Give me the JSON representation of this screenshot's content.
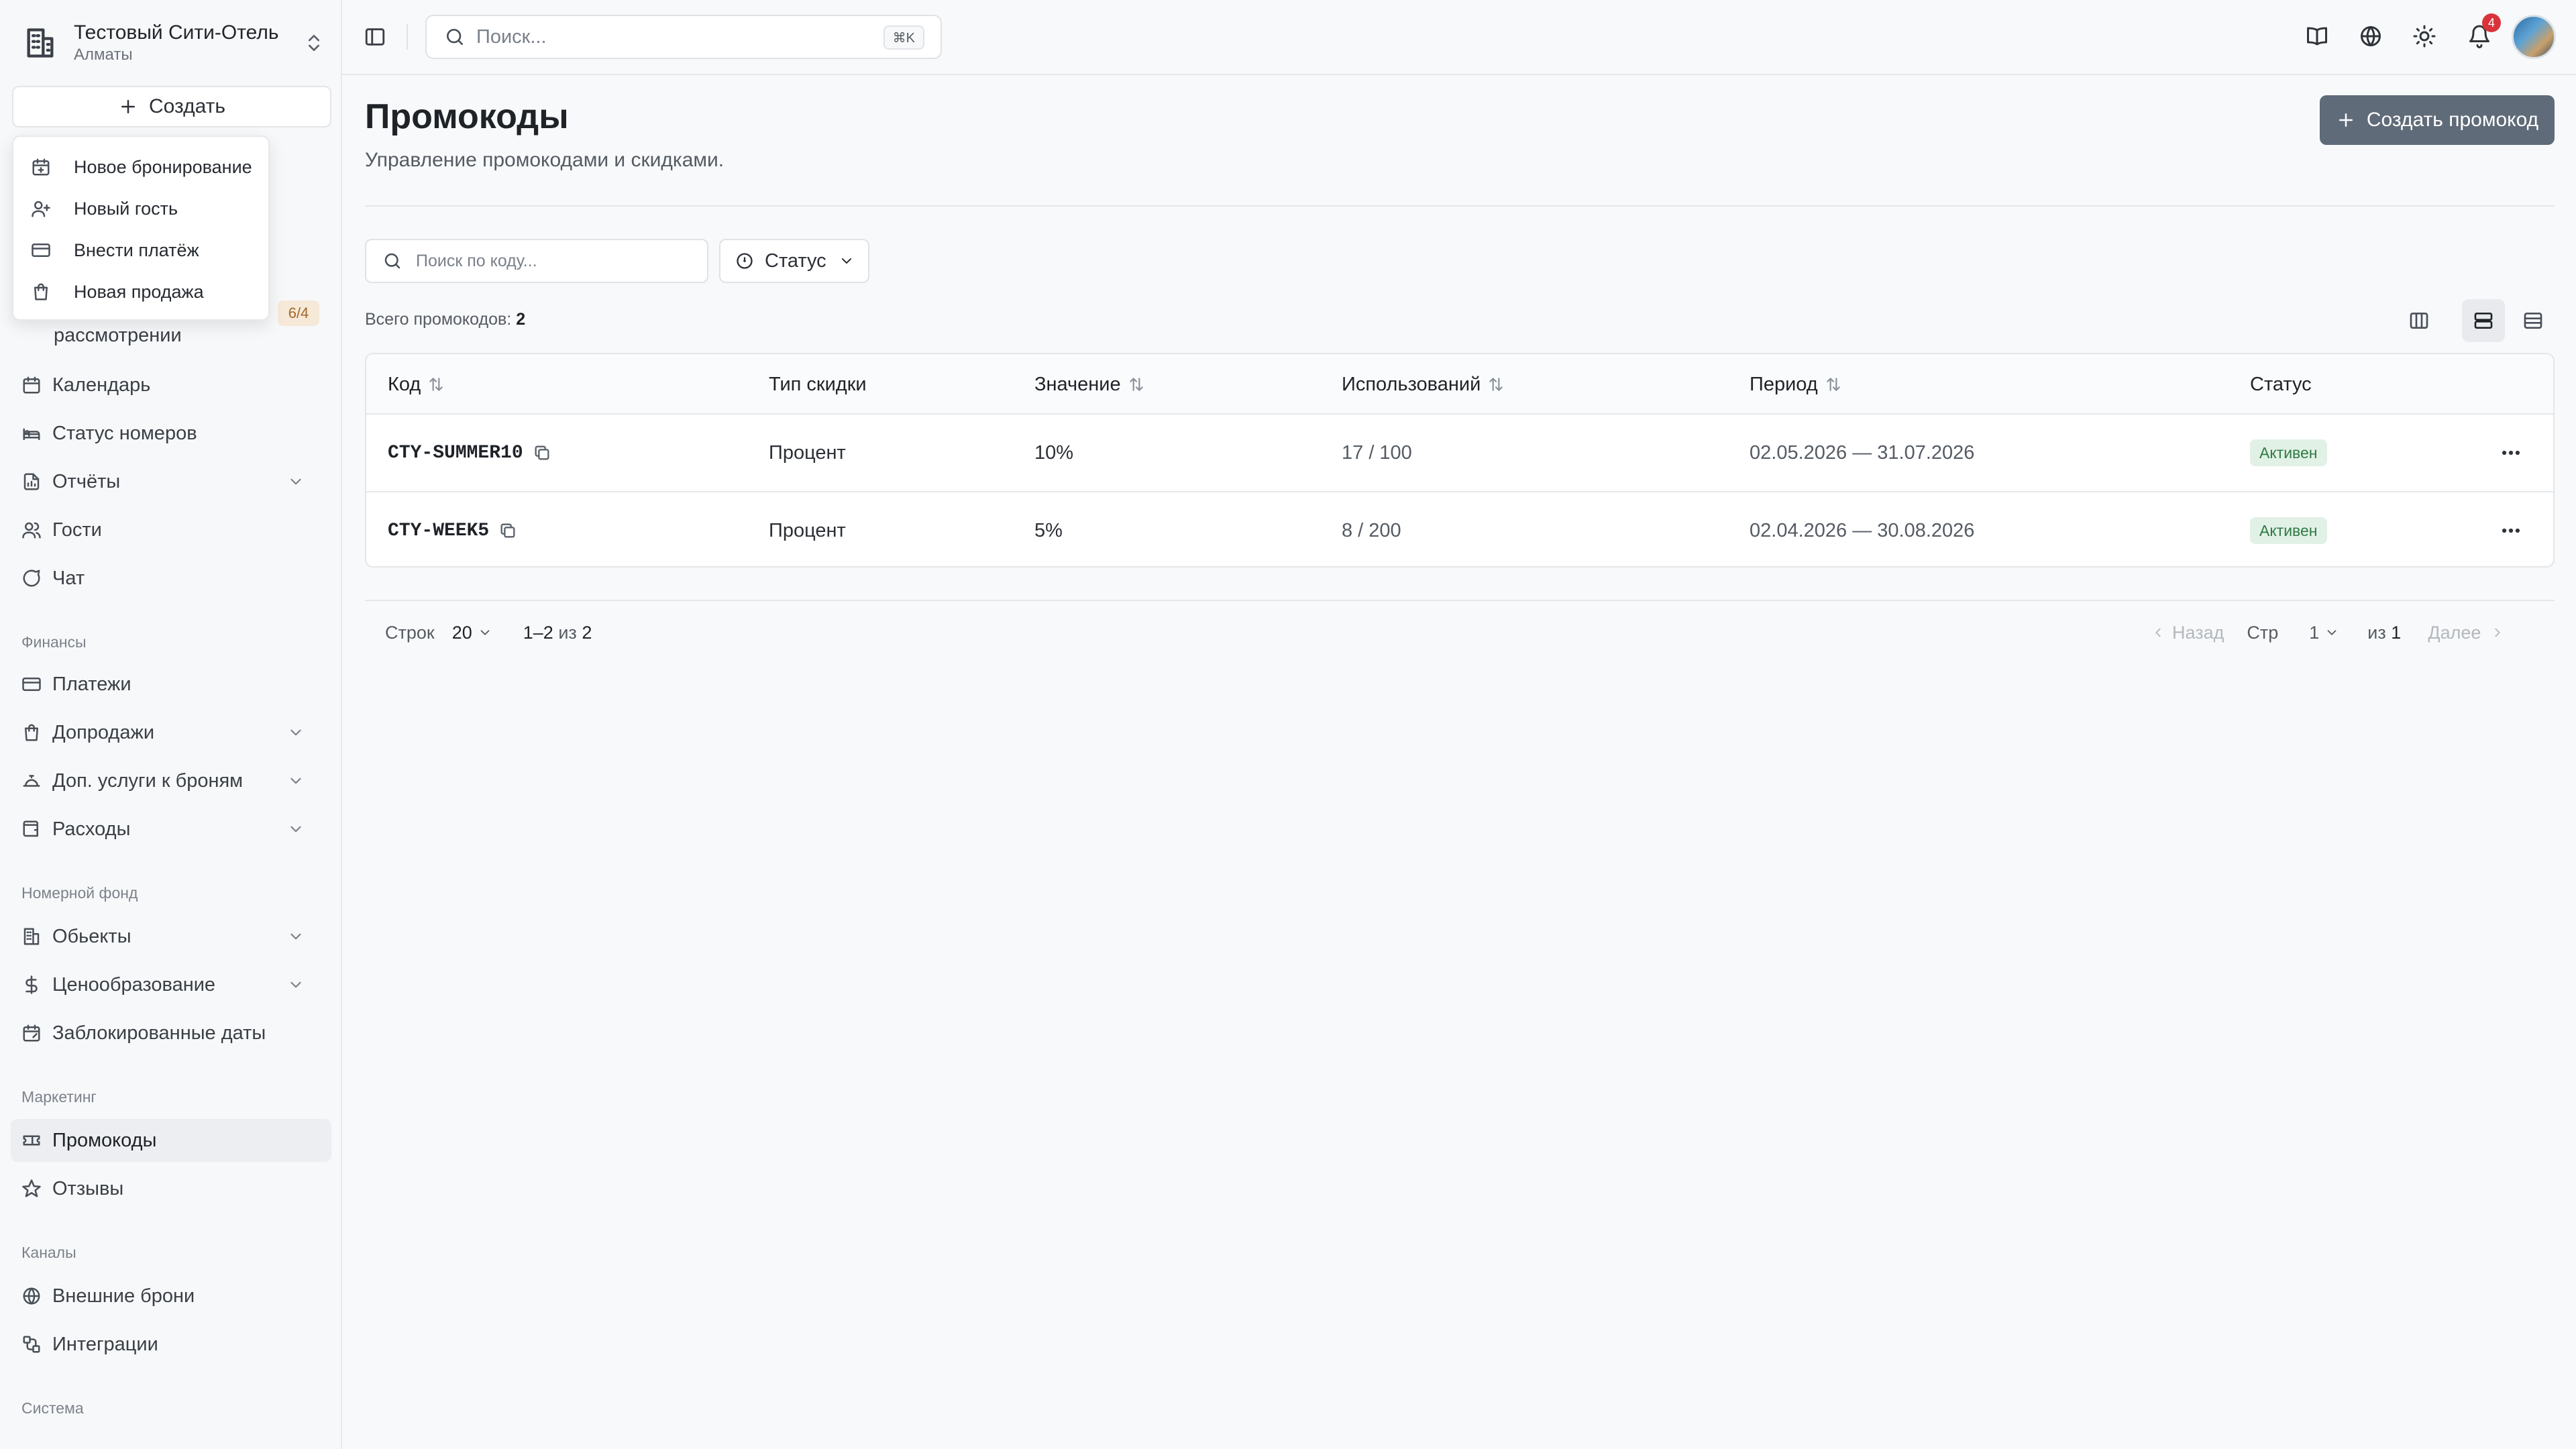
{
  "hotel": {
    "name": "Тестовый Сити-Отель",
    "city": "Алматы"
  },
  "sidebar": {
    "create_label": "Создать",
    "create_menu": [
      {
        "label": "Новое бронирование",
        "icon": "calendar-plus-icon"
      },
      {
        "label": "Новый гость",
        "icon": "user-plus-icon"
      },
      {
        "label": "Внести платёж",
        "icon": "credit-card-icon"
      },
      {
        "label": "Новая продажа",
        "icon": "shopping-bag-icon"
      }
    ],
    "pending_tail": "рассмотрении",
    "pending_badge": "6/4",
    "items_main": [
      {
        "label": "Календарь",
        "icon": "calendar-icon"
      },
      {
        "label": "Статус номеров",
        "icon": "bed-icon"
      },
      {
        "label": "Отчёты",
        "icon": "report-icon",
        "expandable": true
      },
      {
        "label": "Гости",
        "icon": "users-icon"
      },
      {
        "label": "Чат",
        "icon": "chat-icon"
      }
    ],
    "section_finance": "Финансы",
    "items_finance": [
      {
        "label": "Платежи",
        "icon": "credit-card-icon"
      },
      {
        "label": "Допродажи",
        "icon": "shopping-bag-icon",
        "expandable": true
      },
      {
        "label": "Доп. услуги к броням",
        "icon": "service-bell-icon",
        "expandable": true
      },
      {
        "label": "Расходы",
        "icon": "wallet-icon",
        "expandable": true
      }
    ],
    "section_rooms": "Номерной фонд",
    "items_rooms": [
      {
        "label": "Обьекты",
        "icon": "building-icon",
        "expandable": true
      },
      {
        "label": "Ценообразование",
        "icon": "dollar-icon",
        "expandable": true
      },
      {
        "label": "Заблокированные даты",
        "icon": "calendar-lock-icon"
      }
    ],
    "section_marketing": "Маркетинг",
    "items_marketing": [
      {
        "label": "Промокоды",
        "icon": "ticket-icon",
        "active": true
      },
      {
        "label": "Отзывы",
        "icon": "star-icon"
      }
    ],
    "section_channels": "Каналы",
    "items_channels": [
      {
        "label": "Внешние брони",
        "icon": "globe-icon"
      },
      {
        "label": "Интеграции",
        "icon": "integration-icon"
      }
    ],
    "section_system": "Система"
  },
  "topbar": {
    "search_placeholder": "Поиск...",
    "search_shortcut": "⌘K",
    "notifications_count": "4"
  },
  "main": {
    "title": "Промокоды",
    "subtitle": "Управление промокодами и скидками.",
    "create_button": "Создать промокод",
    "code_search_placeholder": "Поиск по коду...",
    "status_filter": "Статус",
    "total_label": "Всего промокодов:",
    "total_value": "2",
    "columns": [
      "Код",
      "Тип скидки",
      "Значение",
      "Использований",
      "Период",
      "Статус"
    ],
    "rows": [
      {
        "code": "CTY-SUMMER10",
        "type": "Процент",
        "value": "10%",
        "uses": "17 / 100",
        "period": "02.05.2026 — 31.07.2026",
        "status": "Активен"
      },
      {
        "code": "CTY-WEEK5",
        "type": "Процент",
        "value": "5%",
        "uses": "8 / 200",
        "period": "02.04.2026 — 30.08.2026",
        "status": "Активен"
      }
    ],
    "pagination": {
      "rows_label": "Строк",
      "rows_value": "20",
      "range": "1–2",
      "of_label": "из",
      "of_total": "2",
      "prev": "Назад",
      "page_label": "Стр",
      "page_value": "1",
      "pages_of_label": "из",
      "pages_total": "1",
      "next": "Далее"
    }
  },
  "colors": {
    "primary_button": "#5f6b78",
    "active_badge_bg": "#e2f1e6",
    "active_badge_text": "#2f7a45",
    "notif_badge": "#d9343b"
  }
}
